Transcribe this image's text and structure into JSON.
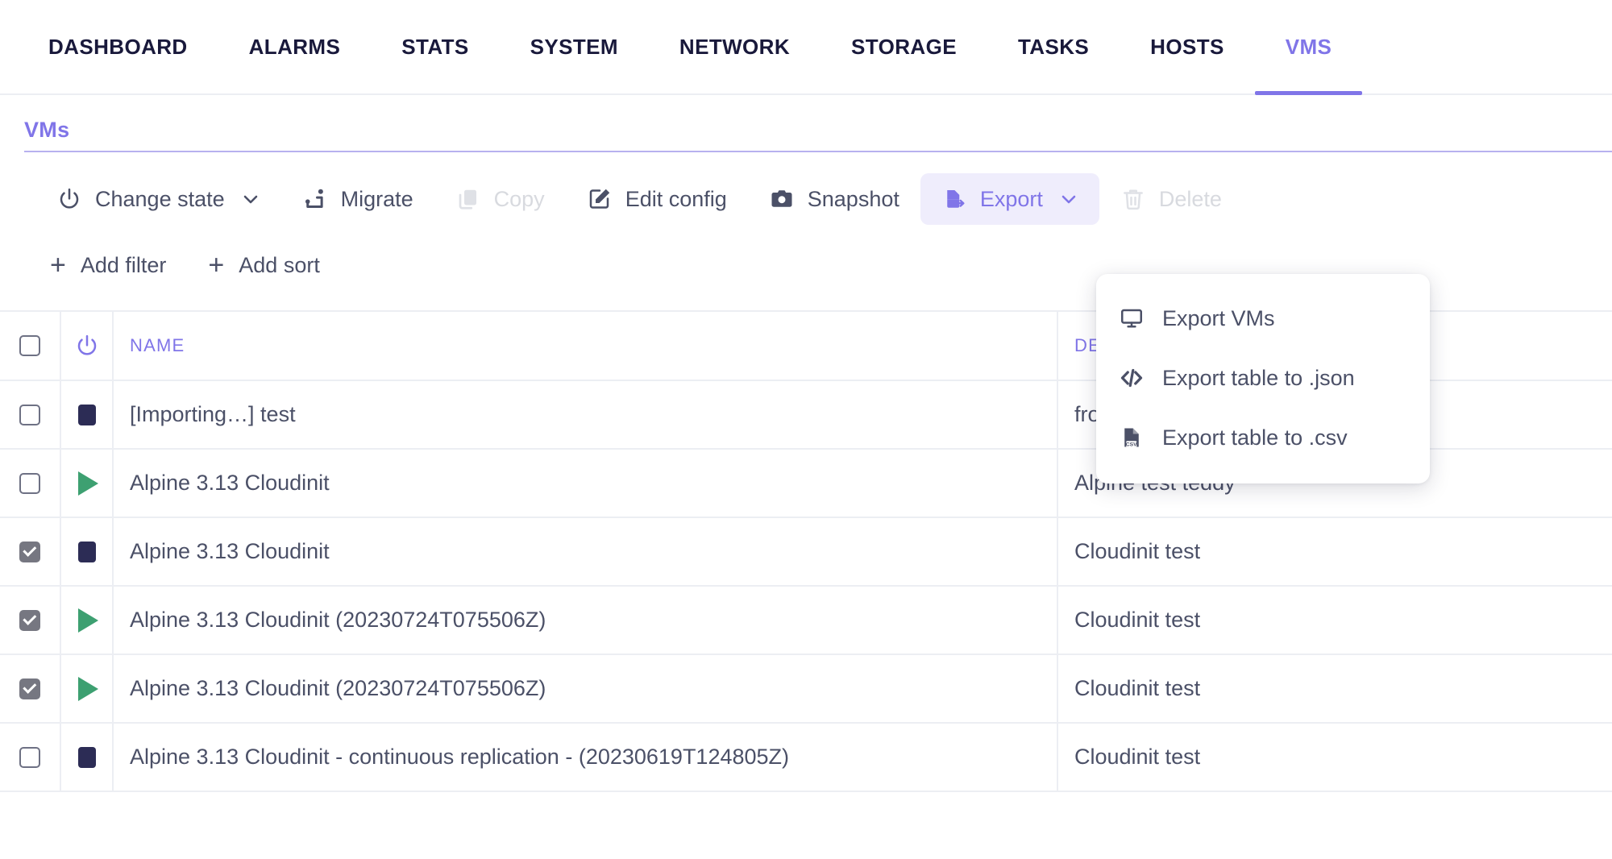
{
  "nav": {
    "tabs": [
      {
        "label": "DASHBOARD",
        "active": false
      },
      {
        "label": "ALARMS",
        "active": false
      },
      {
        "label": "STATS",
        "active": false
      },
      {
        "label": "SYSTEM",
        "active": false
      },
      {
        "label": "NETWORK",
        "active": false
      },
      {
        "label": "STORAGE",
        "active": false
      },
      {
        "label": "TASKS",
        "active": false
      },
      {
        "label": "HOSTS",
        "active": false
      },
      {
        "label": "VMS",
        "active": true
      }
    ]
  },
  "page": {
    "title": "VMs",
    "accent_color": "#8075e8",
    "text_color": "#4b5067",
    "disabled_color": "#d8dadf",
    "running_color": "#3da071",
    "stopped_color": "#2c2c55"
  },
  "toolbar": {
    "change_state": {
      "label": "Change state",
      "icon": "power-icon",
      "has_caret": true,
      "disabled": false
    },
    "migrate": {
      "label": "Migrate",
      "icon": "migrate-icon",
      "disabled": false
    },
    "copy": {
      "label": "Copy",
      "icon": "copy-icon",
      "disabled": true
    },
    "edit_config": {
      "label": "Edit config",
      "icon": "edit-pencil-icon",
      "disabled": false
    },
    "snapshot": {
      "label": "Snapshot",
      "icon": "camera-icon",
      "disabled": false
    },
    "export": {
      "label": "Export",
      "icon": "export-file-icon",
      "has_caret": true,
      "active": true
    },
    "delete": {
      "label": "Delete",
      "icon": "trash-icon",
      "disabled": true
    }
  },
  "export_menu": {
    "open": true,
    "items": [
      {
        "label": "Export VMs",
        "icon": "monitor-icon"
      },
      {
        "label": "Export table to .json",
        "icon": "code-brackets-icon"
      },
      {
        "label": "Export table to .csv",
        "icon": "csv-file-icon"
      }
    ]
  },
  "filters": {
    "add_filter": "Add filter",
    "add_sort": "Add sort"
  },
  "table": {
    "headers": {
      "select_all": "",
      "state": "power-icon",
      "name": "NAME",
      "description": "DESCRIPTION"
    },
    "rows": [
      {
        "checked": false,
        "state": "stopped",
        "name": "[Importing…] test",
        "description": "fro"
      },
      {
        "checked": false,
        "state": "running",
        "name": "Alpine 3.13 Cloudinit",
        "description": "Alpine test teddy"
      },
      {
        "checked": true,
        "state": "stopped",
        "name": "Alpine 3.13 Cloudinit",
        "description": "Cloudinit test"
      },
      {
        "checked": true,
        "state": "running",
        "name": "Alpine 3.13 Cloudinit (20230724T075506Z)",
        "description": "Cloudinit test"
      },
      {
        "checked": true,
        "state": "running",
        "name": "Alpine 3.13 Cloudinit (20230724T075506Z)",
        "description": "Cloudinit test"
      },
      {
        "checked": false,
        "state": "stopped",
        "name": "Alpine 3.13 Cloudinit - continuous replication - (20230619T124805Z)",
        "description": "Cloudinit test"
      }
    ]
  }
}
